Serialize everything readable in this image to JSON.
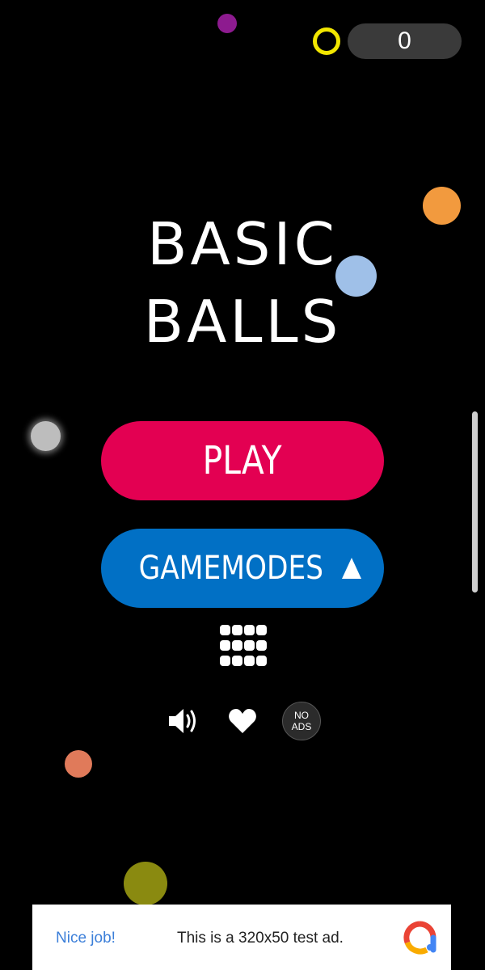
{
  "header": {
    "score": "0",
    "coin_icon": "coin-ring-icon",
    "coin_color": "#f2e600"
  },
  "title": {
    "line1": "BASIC",
    "line2": "BALLS"
  },
  "buttons": {
    "play": {
      "label": "PLAY",
      "color": "#e30052"
    },
    "gamemodes": {
      "label": "GAMEMODES",
      "icon": "arrow-up-icon",
      "color": "#0170c5"
    }
  },
  "menu": {
    "grid_icon": "grid-menu-icon",
    "sound_icon": "sound-on-icon",
    "heart_icon": "heart-icon",
    "no_ads": {
      "line1": "NO",
      "line2": "ADS"
    }
  },
  "ad": {
    "left_text": "Nice job!",
    "main_text": "This is a 320x50 test ad.",
    "logo_icon": "ad-provider-logo-icon"
  },
  "decor_balls": [
    {
      "color": "#8d1b8f"
    },
    {
      "color": "#f29a3e"
    },
    {
      "color": "#9fc0e8"
    },
    {
      "color": "#bdbdbd"
    },
    {
      "color": "#e07a5a"
    },
    {
      "color": "#8a8a10"
    }
  ]
}
